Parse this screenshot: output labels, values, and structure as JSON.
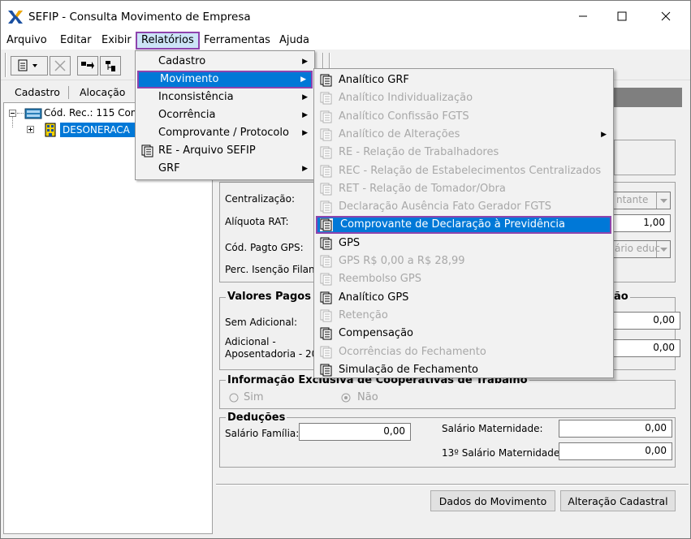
{
  "window": {
    "title": "SEFIP - Consulta Movimento de Empresa"
  },
  "menubar": {
    "arquivo": "Arquivo",
    "editar": "Editar",
    "exibir": "Exibir",
    "relatorios": "Relatórios",
    "ferramentas": "Ferramentas",
    "ajuda": "Ajuda"
  },
  "left_tabs": {
    "cadastro": "Cadastro",
    "alocacao": "Alocação"
  },
  "tree": {
    "root": "Cód. Rec.: 115 Com",
    "child": "DESONERACA"
  },
  "form": {
    "centralizacao_label": "Centralização:",
    "centralizacao_value": "ntante",
    "aliquota_label": "Alíquota RAT:",
    "aliquota_value": "1,00",
    "cod_pagto_label": "Cód. Pagto GPS:",
    "cod_pagto_value": "ário educ",
    "perc_isencao_label": "Perc. Isenção Filant",
    "valores_title": "Valores Pagos a",
    "valores_title_right": "ão",
    "sem_adicional_label": "Sem Adicional:",
    "sem_adicional_value": "0,00",
    "adicional_label_1": "Adicional -",
    "adicional_label_2": "Aposentadoria - 20 a",
    "adicional_value": "0,00",
    "cooperativas_title": "Informação Exclusiva de Cooperativas de Trabalho",
    "sim": "Sim",
    "nao": "Não",
    "deducoes_title": "Deduções",
    "salario_familia_label": "Salário Família:",
    "salario_familia_value": "0,00",
    "salario_maternidade_label": "Salário Maternidade:",
    "salario_maternidade_value": "0,00",
    "decimo_label": "13º Salário Maternidade:",
    "decimo_value": "0,00"
  },
  "buttons": {
    "dados_movimento": "Dados do Movimento",
    "alteracao_cadastral": "Alteração Cadastral"
  },
  "relatorios_menu": [
    {
      "label": "Cadastro",
      "submenu": true
    },
    {
      "label": "Movimento",
      "submenu": true,
      "selected": true
    },
    {
      "label": "Inconsistência",
      "submenu": true
    },
    {
      "label": "Ocorrência",
      "submenu": true
    },
    {
      "label": "Comprovante / Protocolo",
      "submenu": true
    },
    {
      "label": "RE - Arquivo SEFIP",
      "icon": "report-icon"
    },
    {
      "label": "GRF",
      "submenu": true
    }
  ],
  "movimento_menu": [
    {
      "label": "Analítico GRF",
      "enabled": true
    },
    {
      "label": "Analítico Individualização",
      "enabled": false
    },
    {
      "label": "Analítico Confissão FGTS",
      "enabled": false
    },
    {
      "label": "Analítico de Alterações",
      "enabled": false,
      "submenu": true
    },
    {
      "label": "RE - Relação de Trabalhadores",
      "enabled": false
    },
    {
      "label": "REC - Relação de Estabelecimentos Centralizados",
      "enabled": false
    },
    {
      "label": "RET - Relação de Tomador/Obra",
      "enabled": false
    },
    {
      "label": "Declaração Ausência Fato Gerador FGTS",
      "enabled": false
    },
    {
      "label": "Comprovante de Declaração à Previdência",
      "enabled": true,
      "selected": true
    },
    {
      "label": "GPS",
      "enabled": true
    },
    {
      "label": "GPS R$ 0,00 a R$ 28,99",
      "enabled": false
    },
    {
      "label": "Reembolso GPS",
      "enabled": false
    },
    {
      "label": "Analítico GPS",
      "enabled": true
    },
    {
      "label": "Retenção",
      "enabled": false
    },
    {
      "label": "Compensação",
      "enabled": true
    },
    {
      "label": "Ocorrências do Fechamento",
      "enabled": false
    },
    {
      "label": "Simulação de Fechamento",
      "enabled": true
    }
  ]
}
